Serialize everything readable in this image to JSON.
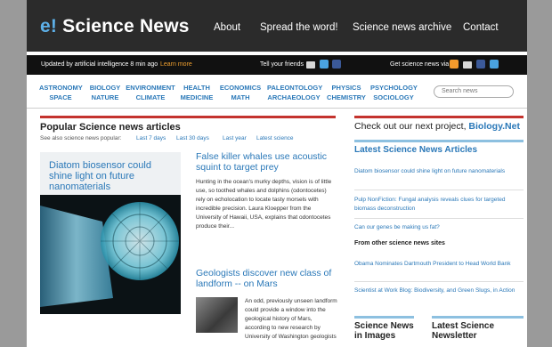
{
  "brand": {
    "e": "e!",
    "name": "Science News"
  },
  "nav": [
    "About",
    "Spread the word!",
    "Science news archive",
    "Contact"
  ],
  "strip": {
    "updated": "Updated by artificial intelligence 8 min ago",
    "learn_more": "Learn more",
    "tell_friends": "Tell your friends",
    "get_news": "Get science news via"
  },
  "categories": [
    [
      "ASTRONOMY",
      "SPACE"
    ],
    [
      "BIOLOGY",
      "NATURE"
    ],
    [
      "ENVIRONMENT",
      "CLIMATE"
    ],
    [
      "HEALTH",
      "MEDICINE"
    ],
    [
      "ECONOMICS",
      "MATH"
    ],
    [
      "PALEONTOLOGY",
      "ARCHAEOLOGY"
    ],
    [
      "PHYSICS",
      "CHEMISTRY"
    ],
    [
      "PSYCHOLOGY",
      "SOCIOLOGY"
    ]
  ],
  "search_placeholder": "Search news",
  "popular": {
    "heading": "Popular Science news articles",
    "see_also": "See also science news popular:",
    "periods": [
      "Last 7 days",
      "Last 30 days",
      "Last year",
      "Latest science"
    ]
  },
  "feature_title": "Diatom biosensor could shine light on future nanomaterials",
  "articles": [
    {
      "title": "False killer whales use acoustic squint to target prey",
      "body": "Hunting in the ocean's murky depths, vision is of little use, so toothed whales and dolphins (odontocetes) rely on echolocation to locate tasty morsels with incredible precision. Laura Kloepper from the University of Hawaii, USA, explains that odontocetes produce their..."
    },
    {
      "title": "Geologists discover new class of landform -- on Mars",
      "body": "An odd, previously unseen landform could provide a window into the geological history of Mars, according to new research by University of Washington geologists"
    }
  ],
  "right": {
    "project_prefix": "Check out our next project,",
    "project_link": "Biology.Net",
    "latest_title": "Latest Science News Articles",
    "latest_links": [
      "Diatom biosensor could shine light on future nanomaterials",
      "Pulp NonFiction: Fungal analysis reveals clues for targeted biomass deconstruction",
      "Can our genes be making us fat?"
    ],
    "other_title": "From other science news sites",
    "other_links": [
      "Obama Nominates Dartmouth President to Head World Bank",
      "Scientist at Work Blog: Biodiversity, and Green Slugs, in Action"
    ],
    "images_title": "Science News in Images",
    "newsletter_title": "Latest Science Newsletter"
  }
}
